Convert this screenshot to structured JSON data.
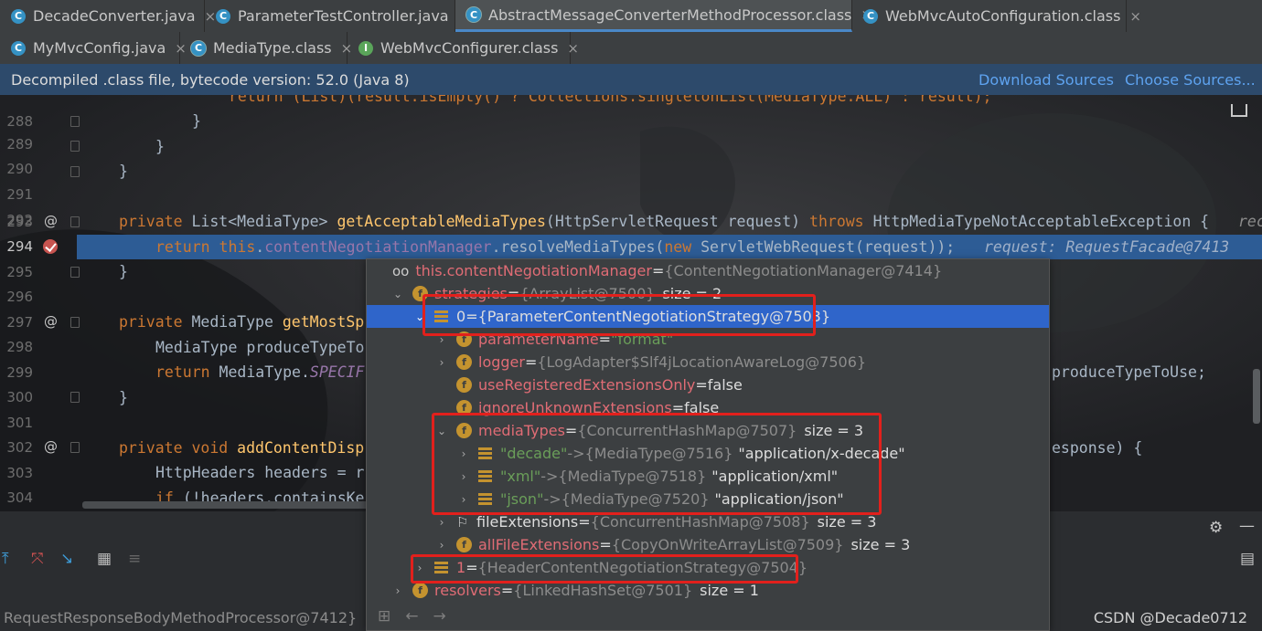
{
  "tabs_row1": [
    {
      "label": "DecadeConverter.java",
      "icon": "class-icon"
    },
    {
      "label": "ParameterTestController.java",
      "icon": "class-icon"
    },
    {
      "label": "AbstractMessageConverterMethodProcessor.class",
      "icon": "class-icon",
      "active": true
    },
    {
      "label": "WebMvcAutoConfiguration.class",
      "icon": "class-icon"
    }
  ],
  "tabs_row2": [
    {
      "label": "MyMvcConfig.java",
      "icon": "class-icon"
    },
    {
      "label": "MediaType.class",
      "icon": "class-icon"
    },
    {
      "label": "WebMvcConfigurer.class",
      "icon": "interface-icon"
    }
  ],
  "banner": {
    "message": "Decompiled .class file, bytecode version: 52.0 (Java 8)",
    "download_sources": "Download Sources",
    "choose_sources": "Choose Sources..."
  },
  "editor": {
    "line_numbers": [
      "288",
      "289",
      "290",
      "291",
      "292",
      "293",
      "294",
      "295",
      "296",
      "297",
      "298",
      "299",
      "300",
      "301",
      "302",
      "303",
      "304"
    ],
    "top_partial": "return (List)(result.isEmpty() ? Collections.singletonList(MediaType.ALL) : result);",
    "l289": "}",
    "l290": "}",
    "l291": "}",
    "l293_a": "private ",
    "l293_b": "List<MediaType> ",
    "l293_c": "getAcceptableMediaTypes",
    "l293_d": "(HttpServletRequest request) ",
    "l293_e": "throws ",
    "l293_f": "HttpMediaTypeNotAcceptableException {",
    "l293_hint": "rec",
    "l294_a": "return ",
    "l294_b": "this",
    "l294_c": ".",
    "l294_d": "contentNegotiationManager",
    "l294_e": ".resolveMediaTypes(",
    "l294_f": "new ",
    "l294_g": "ServletWebRequest(request));",
    "l294_hint": "request: RequestFacade@7413",
    "l295": "}",
    "l297_a": "private ",
    "l297_b": "MediaType ",
    "l297_c": "getMostSp",
    "l298": "MediaType produceTypeTo",
    "l299_a": "return ",
    "l299_b": "MediaType.",
    "l299_c": "SPECIF",
    "l299_right": "produceTypeToUse;",
    "l300": "}",
    "l302_a": "private void ",
    "l302_b": "addContentDisp",
    "l302_right": "esponse) {",
    "l303": "HttpHeaders headers = r",
    "l304_a": "if ",
    "l304_b": "(!headers.containsKe"
  },
  "popup": {
    "root": {
      "name": "this.contentNegotiationManager",
      "eq": " = ",
      "value": "{ContentNegotiationManager@7414}"
    },
    "strategies": {
      "name": "strategies",
      "eq": " = ",
      "value": "{ArrayList@7500}",
      "size": "size = 2"
    },
    "item0": {
      "name": "0",
      "eq": " = ",
      "value": "{ParameterContentNegotiationStrategy@7503}"
    },
    "parameterName": {
      "name": "parameterName",
      "eq": " = ",
      "value": "\"format\""
    },
    "logger": {
      "name": "logger",
      "eq": " = ",
      "value": "{LogAdapter$Slf4jLocationAwareLog@7506}"
    },
    "useRegistered": {
      "name": "useRegisteredExtensionsOnly",
      "eq": " = ",
      "value": "false"
    },
    "ignoreUnknown": {
      "name": "ignoreUnknownExtensions",
      "eq": " = ",
      "value": "false"
    },
    "mediaTypes": {
      "name": "mediaTypes",
      "eq": " = ",
      "value": "{ConcurrentHashMap@7507}",
      "size": "size = 3"
    },
    "entries": [
      {
        "key": "\"decade\"",
        "arrow": " -> ",
        "ref": "{MediaType@7516}",
        "val": "\"application/x-decade\""
      },
      {
        "key": "\"xml\"",
        "arrow": " -> ",
        "ref": "{MediaType@7518}",
        "val": "\"application/xml\""
      },
      {
        "key": "\"json\"",
        "arrow": " -> ",
        "ref": "{MediaType@7520}",
        "val": "\"application/json\""
      }
    ],
    "fileExtensions": {
      "name": "fileExtensions",
      "eq": " = ",
      "value": "{ConcurrentHashMap@7508}",
      "size": "size = 3"
    },
    "allFileExtensions": {
      "name": "allFileExtensions",
      "eq": " = ",
      "value": "{CopyOnWriteArrayList@7509}",
      "size": "size = 3"
    },
    "item1": {
      "name": "1",
      "eq": " = ",
      "value": "{HeaderContentNegotiationStrategy@7504}"
    },
    "resolvers": {
      "name": "resolvers",
      "eq": " = ",
      "value": "{LinkedHashSet@7501}",
      "size": "size = 1"
    }
  },
  "debug": {
    "status": "RequestResponseBodyMethodProcessor@7412}"
  },
  "watermark": "CSDN @Decade0712",
  "colors": {
    "accent": "#2d5c95",
    "highlight_box": "#e2201c",
    "selection": "#2f65ca"
  }
}
